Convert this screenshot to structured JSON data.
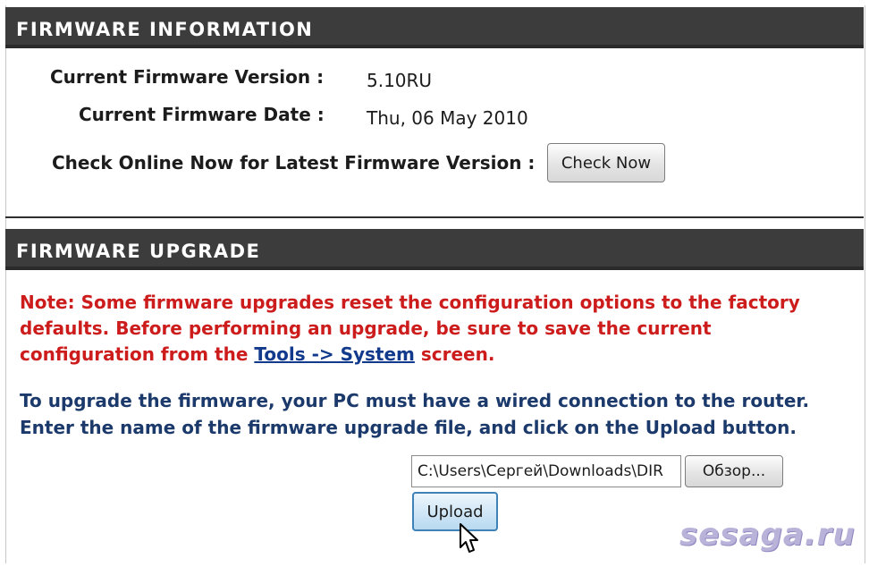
{
  "firmware_information": {
    "header": "FIRMWARE INFORMATION",
    "version_label": "Current Firmware Version :",
    "version_value": "5.10RU",
    "date_label": "Current Firmware Date :",
    "date_value": "Thu, 06 May 2010",
    "check_label": "Check Online Now for Latest Firmware Version :",
    "check_button": "Check Now"
  },
  "firmware_upgrade": {
    "header": "FIRMWARE UPGRADE",
    "note_prefix": "Note: Some firmware upgrades reset the configuration options to the factory defaults. Before performing an upgrade, be sure to save the current configuration from the ",
    "note_link": "Tools -> System",
    "note_suffix": " screen.",
    "instructions": "To upgrade the firmware, your PC must have a wired connection to the router. Enter the name of the firmware upgrade file, and click on the Upload button.",
    "file_path": "C:\\Users\\Сергей\\Downloads\\DIR",
    "browse_button": "Обзор...",
    "upload_button": "Upload"
  },
  "watermark": "sesaga.ru",
  "colors": {
    "header_bg": "#3c3c3c",
    "note_text": "#cc1c1c",
    "instruction_text": "#1b3a6b",
    "link": "#123a8c",
    "upload_accent": "#3f82b8"
  },
  "icons": {
    "cursor": "mouse-pointer-icon"
  }
}
